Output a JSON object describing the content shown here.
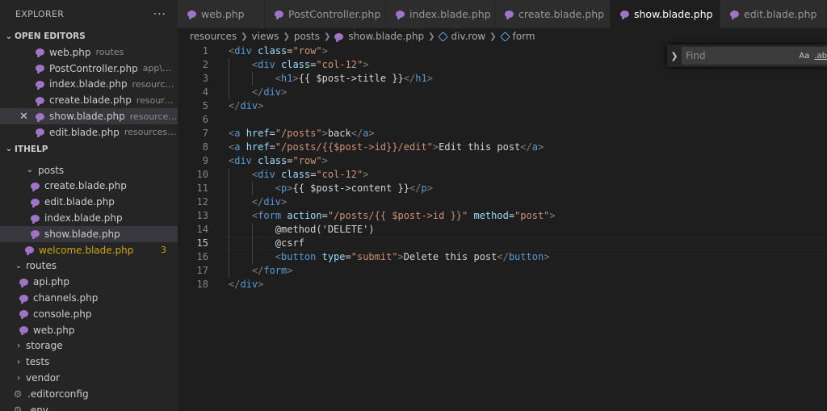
{
  "sidebar": {
    "header": "EXPLORER",
    "more": "···",
    "open_editors": {
      "title": "OPEN EDITORS",
      "items": [
        {
          "name": "web.php",
          "desc": "routes"
        },
        {
          "name": "PostController.php",
          "desc": "app\\Http\\..."
        },
        {
          "name": "index.blade.php",
          "desc": "resources\\vie..."
        },
        {
          "name": "create.blade.php",
          "desc": "resources\\vie..."
        },
        {
          "name": "show.blade.php",
          "desc": "resources\\vie..."
        },
        {
          "name": "edit.blade.php",
          "desc": "resources\\view..."
        }
      ]
    },
    "project": {
      "title": "ITHELP",
      "posts_folder": "posts",
      "posts_files": [
        "create.blade.php",
        "edit.blade.php",
        "index.blade.php",
        "show.blade.php"
      ],
      "welcome": "welcome.blade.php",
      "welcome_badge": "3",
      "routes_folder": "routes",
      "routes_files": [
        "api.php",
        "channels.php",
        "console.php",
        "web.php"
      ],
      "folders": [
        "storage",
        "tests",
        "vendor"
      ],
      "editorconfig": ".editorconfig",
      "env": ".env"
    }
  },
  "tabs": [
    "web.php",
    "PostController.php",
    "index.blade.php",
    "create.blade.php",
    "show.blade.php",
    "edit.blade.php"
  ],
  "breadcrumb": [
    "resources",
    "views",
    "posts",
    "show.blade.php",
    "div.row",
    "form"
  ],
  "find": {
    "placeholder": "Find",
    "opt_case": "Aa",
    "opt_word": ".ab"
  },
  "editor": {
    "lines": [
      "1",
      "2",
      "3",
      "4",
      "5",
      "6",
      "7",
      "8",
      "9",
      "10",
      "11",
      "12",
      "13",
      "14",
      "15",
      "16",
      "17",
      "18"
    ],
    "code": {
      "l1": {
        "o": "<",
        "t": "div",
        "a": " class",
        "e": "=",
        "s": "\"row\"",
        "c": ">"
      },
      "l2": {
        "o": "<",
        "t": "div",
        "a": " class",
        "e": "=",
        "s": "\"col-12\"",
        "c": ">"
      },
      "l3": {
        "o": "<",
        "t": "h1",
        "c": ">",
        "x": "{{ $post->title }}",
        "o2": "</",
        "t2": "h1",
        "c2": ">"
      },
      "l4": {
        "o": "</",
        "t": "div",
        "c": ">"
      },
      "l5": {
        "o": "</",
        "t": "div",
        "c": ">"
      },
      "l7": {
        "o": "<",
        "t": "a",
        "a": " href",
        "e": "=",
        "s": "\"/posts\"",
        "c": ">",
        "x": "back",
        "o2": "</",
        "t2": "a",
        "c2": ">"
      },
      "l8": {
        "o": "<",
        "t": "a",
        "a": " href",
        "e": "=",
        "s": "\"/posts/{{$post->id}}/edit\"",
        "c": ">",
        "x": "Edit this post",
        "o2": "</",
        "t2": "a",
        "c2": ">"
      },
      "l9": {
        "o": "<",
        "t": "div",
        "a": " class",
        "e": "=",
        "s": "\"row\"",
        "c": ">"
      },
      "l10": {
        "o": "<",
        "t": "div",
        "a": " class",
        "e": "=",
        "s": "\"col-12\"",
        "c": ">"
      },
      "l11": {
        "o": "<",
        "t": "p",
        "c": ">",
        "x": "{{ $post->content }}",
        "o2": "</",
        "t2": "p",
        "c2": ">"
      },
      "l12": {
        "o": "</",
        "t": "div",
        "c": ">"
      },
      "l13": {
        "o": "<",
        "t": "form",
        "a": " action",
        "e": "=",
        "s": "\"/posts/{{ $post->id }}\"",
        "a2": " method",
        "e2": "=",
        "s2": "\"post\"",
        "c": ">"
      },
      "l14": {
        "x": "@method('DELETE')"
      },
      "l15": {
        "x": "@csrf"
      },
      "l16": {
        "o": "<",
        "t": "button",
        "a": " type",
        "e": "=",
        "s": "\"submit\"",
        "c": ">",
        "x": "Delete this post",
        "o2": "</",
        "t2": "button",
        "c2": ">"
      },
      "l17": {
        "o": "</",
        "t": "form",
        "c": ">"
      },
      "l18": {
        "o": "</",
        "t": "div",
        "c": ">"
      }
    }
  }
}
